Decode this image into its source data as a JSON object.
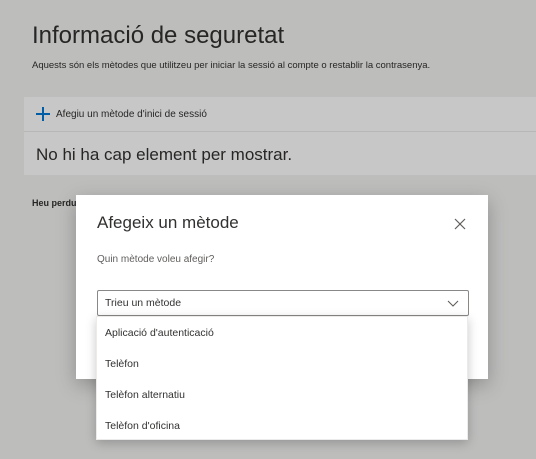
{
  "page": {
    "title": "Informació de seguretat",
    "subtitle": "Aquests són els mètodes que utilitzeu per iniciar la sessió al compte o restablir la contrasenya.",
    "add_method_label": "Afegiu un mètode d'inici de sessió",
    "empty_message": "No hi ha cap element per mostrar.",
    "lost_device_text": "Heu perdut el dispositiu? Tanqueu la sessió a tot arreu"
  },
  "dialog": {
    "title": "Afegeix un mètode",
    "question": "Quin mètode voleu afegir?",
    "select_placeholder": "Trieu un mètode",
    "options": [
      "Aplicació d'autenticació",
      "Telèfon",
      "Telèfon alternatiu",
      "Telèfon d'oficina"
    ]
  },
  "colors": {
    "accent": "#0078d4",
    "text": "#323130",
    "overlay": "rgba(0,0,0,0.22)"
  },
  "icons": {
    "add": "plus-icon",
    "close": "close-icon",
    "dropdown": "chevron-down-icon"
  }
}
